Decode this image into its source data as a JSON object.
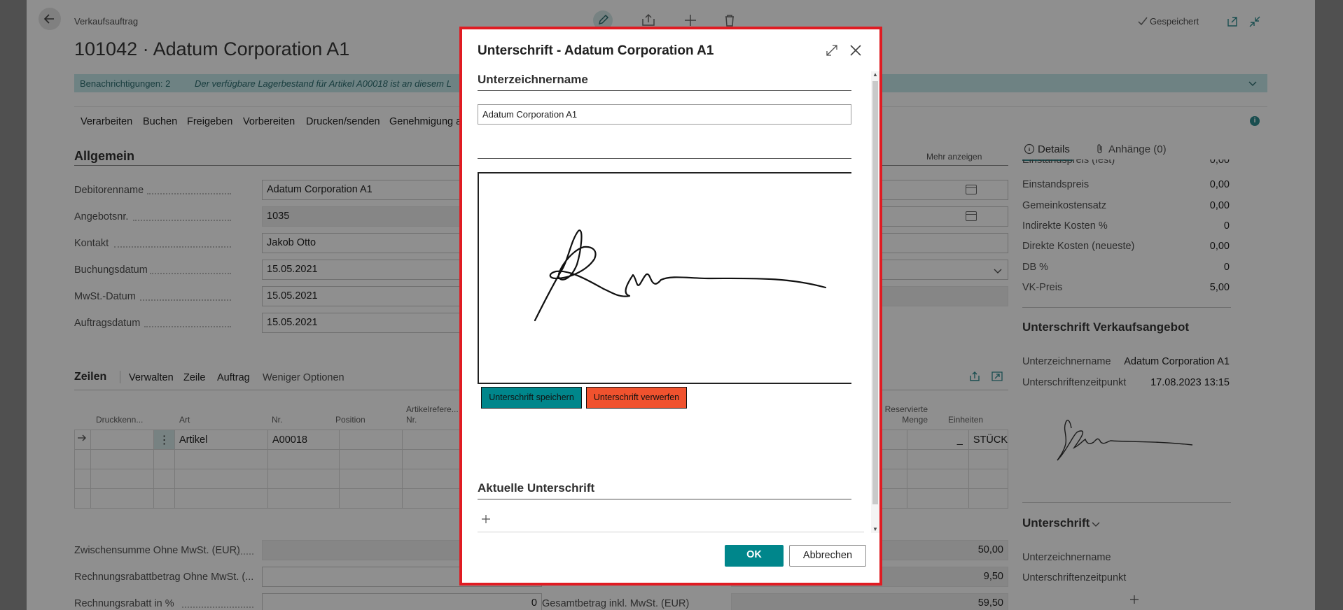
{
  "header": {
    "breadcrumb": "Verkaufsauftrag",
    "title": "101042 · Adatum Corporation A1",
    "saved_status": "Gespeichert"
  },
  "notification": {
    "count_label": "Benachrichtigungen: 2",
    "message": "Der verfügbare Lagerbestand für Artikel A00018 ist an diesem L"
  },
  "actions": [
    "Verarbeiten",
    "Buchen",
    "Freigeben",
    "Vorbereiten",
    "Drucken/senden",
    "Genehmigung a"
  ],
  "general": {
    "title": "Allgemein",
    "show_more": "Mehr anzeigen",
    "fields": [
      {
        "label": "Debitorenname",
        "value": "Adatum Corporation A1"
      },
      {
        "label": "Angebotsnr.",
        "value": "1035"
      },
      {
        "label": "Kontakt",
        "value": "Jakob Otto"
      },
      {
        "label": "Buchungsdatum",
        "value": "15.05.2021"
      },
      {
        "label": "MwSt.-Datum",
        "value": "15.05.2021"
      },
      {
        "label": "Auftragsdatum",
        "value": "15.05.2021"
      }
    ]
  },
  "lines": {
    "title": "Zeilen",
    "menu": [
      "Verwalten",
      "Zeile",
      "Auftrag",
      "Weniger Optionen"
    ],
    "columns": [
      "Druckkenn...",
      "Art",
      "Nr.",
      "Position",
      "Artikelrefere... Nr.",
      "Reservierte Menge",
      "Einheiten"
    ],
    "row": {
      "type": "Artikel",
      "no": "A00018",
      "reserved": "_",
      "unit": "STÜCK"
    }
  },
  "totals": {
    "subtotal_label": "Zwischensumme Ohne MwSt. (EUR)",
    "invoice_discount_amount_label": "Rechnungsrabattbetrag Ohne MwSt. (...",
    "invoice_discount_pct_label": "Rechnungsrabatt in %",
    "invoice_discount_pct_value": "0",
    "total_incl_label": "Gesamtbetrag inkl. MwSt. (EUR)",
    "right_values": [
      "50,00",
      "9,50",
      "59,50"
    ]
  },
  "factbox": {
    "tabs": [
      "Details",
      "Anhänge (0)"
    ],
    "details": [
      {
        "label": "Einstandspreis (fest)",
        "value": "0,00"
      },
      {
        "label": "Einstandspreis",
        "value": "0,00"
      },
      {
        "label": "Gemeinkostensatz",
        "value": "0,00"
      },
      {
        "label": "Indirekte Kosten %",
        "value": "0"
      },
      {
        "label": "Direkte Kosten (neueste)",
        "value": "0,00"
      },
      {
        "label": "DB %",
        "value": "0"
      },
      {
        "label": "VK-Preis",
        "value": "5,00"
      }
    ],
    "quote_signature": {
      "title": "Unterschrift Verkaufsangebot",
      "signer_label": "Unterzeichnername",
      "signer_value": "Adatum Corporation A1",
      "time_label": "Unterschriftenzeitpunkt",
      "time_value": "17.08.2023 13:15"
    },
    "signature": {
      "title": "Unterschrift",
      "signer_label": "Unterzeichnername",
      "time_label": "Unterschriftenzeitpunkt"
    }
  },
  "dialog": {
    "title": "Unterschrift - Adatum Corporation A1",
    "signer_section": "Unterzeichnername",
    "signer_value": "Adatum Corporation A1",
    "save_button": "Unterschrift speichern",
    "discard_button": "Unterschrift verwerfen",
    "current_section": "Aktuelle Unterschrift",
    "ok": "OK",
    "cancel": "Abbrechen"
  },
  "colors": {
    "accent": "#008489",
    "notification_bg": "#c4e8e9",
    "discard": "#f0522e",
    "highlight": "#e01b22"
  }
}
